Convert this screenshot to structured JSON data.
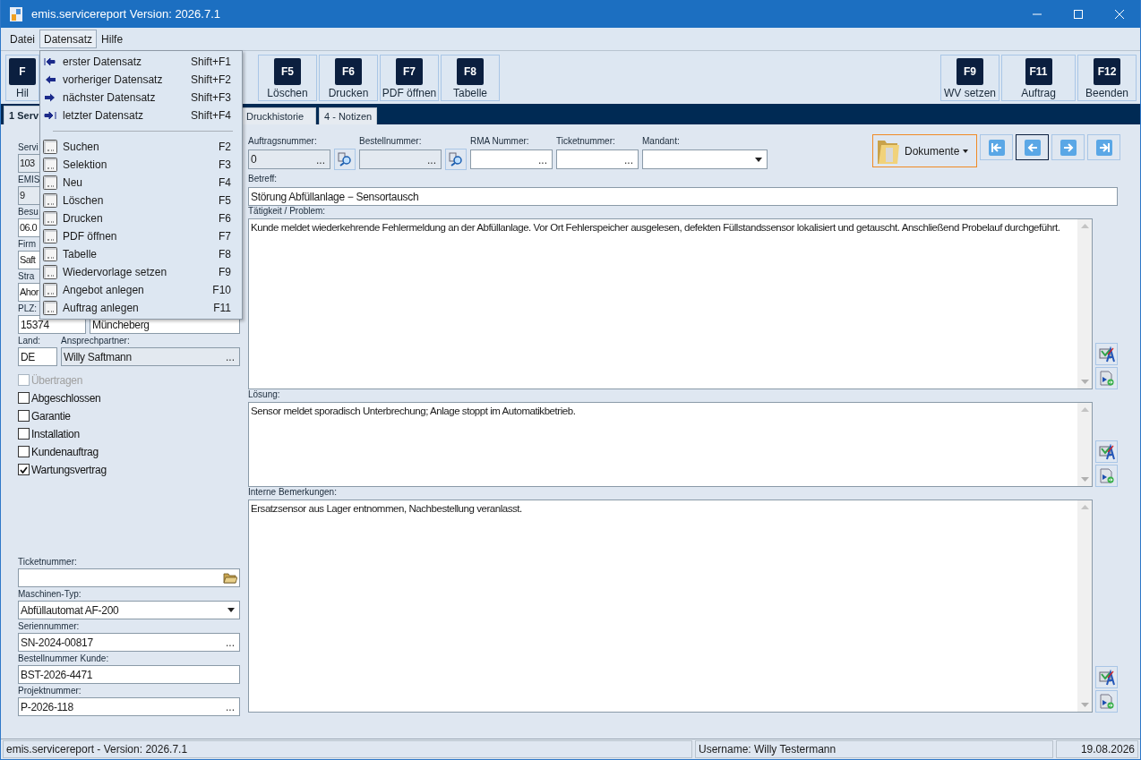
{
  "window": {
    "title": "emis.servicereport Version: 2026.7.1"
  },
  "menubar": [
    {
      "label": "Datei",
      "selected": false
    },
    {
      "label": "Datensatz",
      "selected": true
    },
    {
      "label": "Hilfe",
      "selected": false
    }
  ],
  "dropdown": [
    {
      "kind": "first",
      "label": "erster Datensatz",
      "shortcut": "Shift+F1"
    },
    {
      "kind": "previous",
      "label": "vorheriger Datensatz",
      "shortcut": "Shift+F2"
    },
    {
      "kind": "next",
      "label": "nächster Datensatz",
      "shortcut": "Shift+F3"
    },
    {
      "kind": "last",
      "label": "letzter Datensatz",
      "shortcut": "Shift+F4"
    },
    {
      "kind": "separator"
    },
    {
      "kind": "command",
      "label": "Suchen",
      "shortcut": "F2"
    },
    {
      "kind": "command",
      "label": "Selektion",
      "shortcut": "F3"
    },
    {
      "kind": "command",
      "label": "Neu",
      "shortcut": "F4"
    },
    {
      "kind": "command",
      "label": "Löschen",
      "shortcut": "F5"
    },
    {
      "kind": "command",
      "label": "Drucken",
      "shortcut": "F6"
    },
    {
      "kind": "command",
      "label": "PDF öffnen",
      "shortcut": "F7"
    },
    {
      "kind": "command",
      "label": "Tabelle",
      "shortcut": "F8"
    },
    {
      "kind": "command",
      "label": "Wiedervorlage setzen",
      "shortcut": "F9"
    },
    {
      "kind": "command",
      "label": "Angebot anlegen",
      "shortcut": "F10"
    },
    {
      "kind": "command",
      "label": "Auftrag anlegen",
      "shortcut": "F11"
    }
  ],
  "toolbar": {
    "left": [
      {
        "key": "F",
        "label": "Hil"
      }
    ],
    "middle": [
      {
        "key": "F5",
        "label": "Löschen"
      },
      {
        "key": "F6",
        "label": "Drucken"
      },
      {
        "key": "F7",
        "label": "PDF öffnen"
      },
      {
        "key": "F8",
        "label": "Tabelle"
      }
    ],
    "right": [
      {
        "key": "F9",
        "label": "WV setzen"
      },
      {
        "key": "F11",
        "label": "Auftrag"
      },
      {
        "key": "F12",
        "label": "Beenden"
      }
    ]
  },
  "tabs": [
    {
      "label": "1 Serv",
      "selected": true
    },
    {
      "label": "Druckhistorie",
      "selected": false
    },
    {
      "label": "4 - Notizen",
      "selected": false
    }
  ],
  "left_form": {
    "rows": [
      {
        "fields": [
          {
            "label": "Servi",
            "value": "103",
            "readonly": true,
            "kind": "text"
          }
        ]
      },
      {
        "fields": [
          {
            "label": "EMIS",
            "value": "9",
            "readonly": true,
            "kind": "text"
          }
        ]
      },
      {
        "fields": [
          {
            "label": "Besu",
            "value": "06.0",
            "readonly": false,
            "kind": "text"
          }
        ]
      },
      {
        "fields": [
          {
            "label": "Firm",
            "value": "Saft",
            "readonly": false,
            "kind": "text"
          }
        ]
      },
      {
        "fields": [
          {
            "label": "Stra",
            "value": "Ahor",
            "readonly": false,
            "kind": "text"
          }
        ]
      },
      {
        "fields": [
          {
            "label": "PLZ:",
            "value": "15374",
            "readonly": false,
            "kind": "text"
          },
          {
            "value": "Müncheberg",
            "readonly": false,
            "kind": "text"
          }
        ]
      },
      {
        "fields": [
          {
            "label": "Land:",
            "value": "DE",
            "readonly": false,
            "kind": "text"
          },
          {
            "label": "Ansprechpartner:",
            "value": "Willy Saftmann",
            "readonly": true,
            "kind": "ellipsis",
            "button_label": "..."
          }
        ]
      }
    ],
    "checkboxes": [
      {
        "label": "Übertragen",
        "checked": false,
        "disabled": true
      },
      {
        "label": "Abgeschlossen",
        "checked": false,
        "disabled": false
      },
      {
        "label": "Garantie",
        "checked": false,
        "disabled": false
      },
      {
        "label": "Installation",
        "checked": false,
        "disabled": false
      },
      {
        "label": "Kundenauftrag",
        "checked": false,
        "disabled": false
      },
      {
        "label": "Wartungsvertrag",
        "checked": true,
        "disabled": false
      }
    ],
    "bottom_fields": [
      {
        "label": "Ticketnummer:",
        "kind": "folder",
        "readonly": false
      },
      {
        "label": "Maschinen-Typ:",
        "value": "Abfüllautomat AF-200",
        "kind": "dropdown",
        "readonly": false
      },
      {
        "label": "Seriennummer:",
        "value": "SN-2024-00817",
        "kind": "ellipsis",
        "button_label": "...",
        "readonly": false
      },
      {
        "label": "Bestellnummer Kunde:",
        "value": "BST-2026-4471",
        "kind": "text",
        "readonly": false
      },
      {
        "label": "Projektnummer:",
        "value": "P-2026-118",
        "kind": "ellipsis",
        "button_label": "...",
        "readonly": false
      }
    ]
  },
  "right_form": {
    "top_fields": [
      {
        "label": "Auftragsnummer:",
        "value": "0",
        "kind": "ellipsis",
        "button_label": "...",
        "readonly": true,
        "search_button": true
      },
      {
        "label": "Bestellnummer:",
        "kind": "ellipsis",
        "button_label": "...",
        "readonly": true,
        "search_button": true
      },
      {
        "label": "RMA Nummer:",
        "kind": "ellipsis",
        "button_label": "...",
        "readonly": false
      },
      {
        "label": "Ticketnummer:",
        "kind": "ellipsis",
        "button_label": "...",
        "readonly": false
      },
      {
        "label": "Mandant:",
        "kind": "dropdown",
        "readonly": false
      }
    ],
    "documents_button": {
      "label": "Dokumente"
    },
    "record_nav": [
      {
        "kind": "first",
        "selected": false
      },
      {
        "kind": "previous",
        "selected": true
      },
      {
        "kind": "next",
        "selected": false
      },
      {
        "kind": "last",
        "selected": false
      }
    ],
    "subject": {
      "label": "Betreff:",
      "value": "Störung Abfüllanlage − Sensortausch"
    },
    "text_areas": [
      {
        "label": "Tätigkeit / Problem:",
        "value": "Kunde meldet wiederkehrende Fehlermeldung an der Abfüllanlage. Vor Ort Fehlerspeicher ausgelesen, defekten Füllstandssensor lokalisiert und getauscht. Anschließend Probelauf durchgeführt."
      },
      {
        "label": "Lösung:",
        "value": "Sensor meldet sporadisch Unterbrechung; Anlage stoppt im Automatikbetrieb."
      },
      {
        "label": "Interne Bemerkungen:",
        "value": "Ersatzsensor aus Lager entnommen, Nachbestellung veranlasst."
      }
    ]
  },
  "status_bar": [
    "emis.servicereport - Version: 2026.7.1",
    "Username: Willy Testermann",
    "19.08.2026"
  ]
}
